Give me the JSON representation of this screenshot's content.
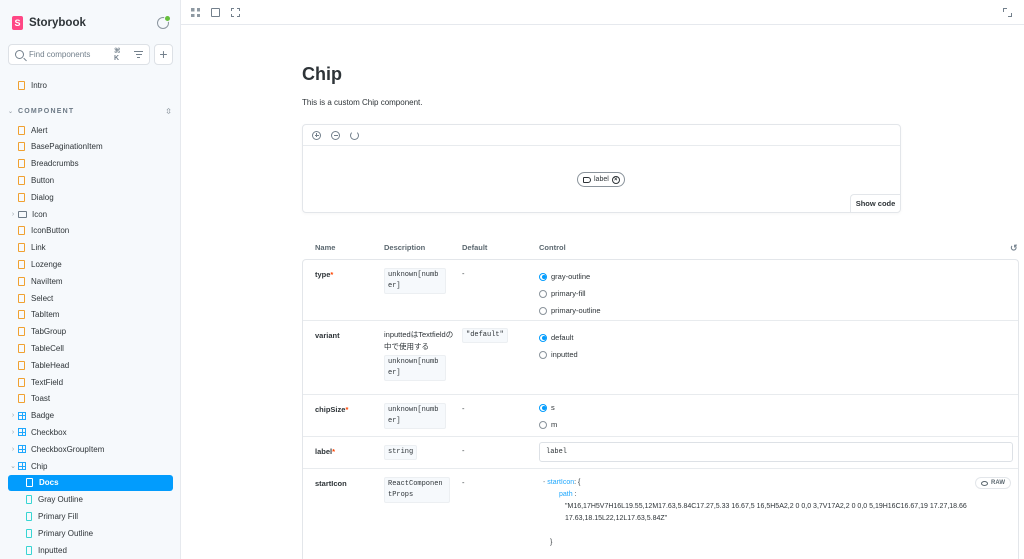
{
  "brand": {
    "name": "Storybook",
    "logo_letter": "S"
  },
  "search": {
    "placeholder": "Find components",
    "shortcut": "⌘ K"
  },
  "sidebar": {
    "intro": "Intro",
    "group_label": "COMPONENT",
    "items": [
      {
        "label": "Alert",
        "kind": "doc"
      },
      {
        "label": "BasePaginationItem",
        "kind": "doc"
      },
      {
        "label": "Breadcrumbs",
        "kind": "doc"
      },
      {
        "label": "Button",
        "kind": "doc"
      },
      {
        "label": "Dialog",
        "kind": "doc"
      },
      {
        "label": "Icon",
        "kind": "folder"
      },
      {
        "label": "IconButton",
        "kind": "doc"
      },
      {
        "label": "Link",
        "kind": "doc"
      },
      {
        "label": "Lozenge",
        "kind": "doc"
      },
      {
        "label": "NaviItem",
        "kind": "doc"
      },
      {
        "label": "Select",
        "kind": "doc"
      },
      {
        "label": "TabItem",
        "kind": "doc"
      },
      {
        "label": "TabGroup",
        "kind": "doc"
      },
      {
        "label": "TableCell",
        "kind": "doc"
      },
      {
        "label": "TableHead",
        "kind": "doc"
      },
      {
        "label": "TextField",
        "kind": "doc"
      },
      {
        "label": "Toast",
        "kind": "doc"
      },
      {
        "label": "Badge",
        "kind": "component"
      },
      {
        "label": "Checkbox",
        "kind": "component"
      },
      {
        "label": "CheckboxGroupItem",
        "kind": "component"
      },
      {
        "label": "Chip",
        "kind": "component-open"
      },
      {
        "label": "Docs",
        "kind": "active-doc"
      },
      {
        "label": "Gray Outline",
        "kind": "story"
      },
      {
        "label": "Primary Fill",
        "kind": "story"
      },
      {
        "label": "Primary Outline",
        "kind": "story"
      },
      {
        "label": "Inputted",
        "kind": "story"
      }
    ]
  },
  "main": {
    "title": "Chip",
    "subtitle": "This is a custom Chip component.",
    "chip_label": "label",
    "show_code": "Show code"
  },
  "table": {
    "headers": {
      "name": "Name",
      "description": "Description",
      "default": "Default",
      "control": "Control"
    },
    "rows": {
      "type": {
        "name": "type",
        "desc_code": "unknown[number]",
        "default": "-",
        "options": [
          "gray-outline",
          "primary-fill",
          "primary-outline"
        ],
        "selected": "gray-outline"
      },
      "variant": {
        "name": "variant",
        "desc_text": "inputtedはTextfieldの中で使用する",
        "desc_code": "unknown[number]",
        "default": "\"default\"",
        "options": [
          "default",
          "inputted"
        ],
        "selected": "default"
      },
      "chipSize": {
        "name": "chipSize",
        "desc_code": "unknown[number]",
        "default": "-",
        "options": [
          "s",
          "m"
        ],
        "selected": "s"
      },
      "label": {
        "name": "label",
        "desc_code": "string",
        "default": "-",
        "value": "label"
      },
      "startIcon": {
        "name": "startIcon",
        "desc_code": "ReactComponentProps",
        "default": "-",
        "json_key": "startIcon",
        "json_open": ": {",
        "json_path_key": "path",
        "json_path_colon": ":",
        "json_path_value": "\"M16,17H5V7H16L19.55,12M17.63,5.84C17.27,5.33 16.67,5 16,5H5A2,2 0 0,0 3,7V17A2,2 0 0,0 5,19H16C16.67,19 17.27,18.66 17.63,18.15L22,12L17.63,5.84Z\"",
        "json_close": "}",
        "raw_label": "RAW"
      }
    }
  },
  "colors": {
    "accent": "#029cfd",
    "brand": "#ff4785",
    "required": "#ff4400",
    "sidebar_bg": "#f6f9fc"
  }
}
